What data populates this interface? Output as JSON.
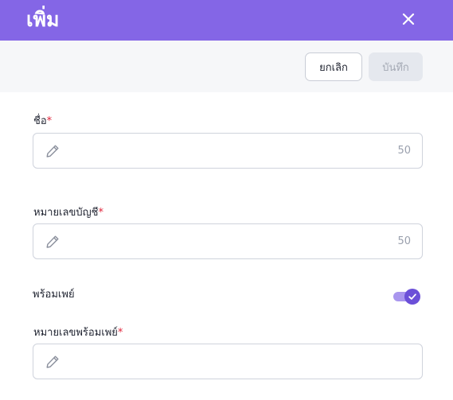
{
  "header": {
    "title": "เพิ่ม",
    "close_icon": "close-icon",
    "background": "#8466e6"
  },
  "toolbar": {
    "cancel_label": "ยกเลิก",
    "save_label": "บันทึก"
  },
  "form": {
    "name": {
      "label": "ชื่อ",
      "required_mark": "*",
      "value": "",
      "counter": "50",
      "icon": "pencil-icon"
    },
    "account_number": {
      "label": "หมายเลขบัญชี",
      "required_mark": "*",
      "value": "",
      "counter": "50",
      "icon": "pencil-icon"
    },
    "promptpay_toggle": {
      "label": "พร้อมเพย์",
      "checked": true,
      "color": "#6b4fd8"
    },
    "promptpay_number": {
      "label": "หมายเลขพร้อมเพย์",
      "required_mark": "*",
      "value": "",
      "icon": "pencil-icon"
    }
  }
}
